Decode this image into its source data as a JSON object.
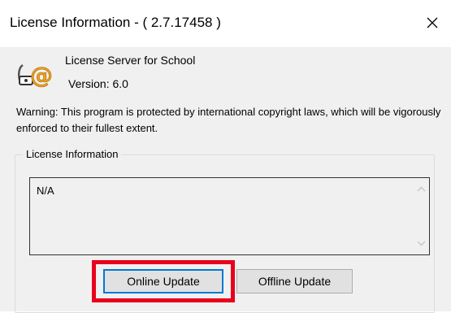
{
  "window": {
    "title": "License Information - ( 2.7.17458 )",
    "close_icon": "close-icon"
  },
  "header": {
    "app_icon": "license-at-icon",
    "product_name": "License Server for School",
    "version": "Version: 6.0"
  },
  "warning_text": "Warning: This program is protected by international copyright laws, which will be vigorously enforced to their fullest extent.",
  "license_group": {
    "label": "License Information",
    "value": "N/A"
  },
  "buttons": {
    "online_update": "Online Update",
    "offline_update": "Offline Update"
  },
  "colors": {
    "highlight": "#e8001c",
    "focus_border": "#0078d7",
    "icon_accent": "#e8a020"
  }
}
